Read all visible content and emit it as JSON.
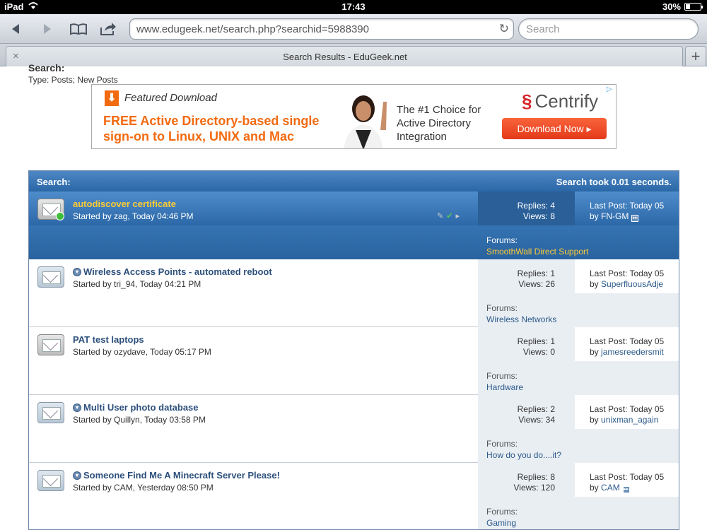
{
  "status": {
    "device": "iPad",
    "time": "17:43",
    "battery_text": "30%",
    "battery_level": 0.3
  },
  "browser": {
    "url": "www.edugeek.net/search.php?searchid=5988390",
    "search_placeholder": "Search",
    "tab_title": "Search Results - EduGeek.net"
  },
  "page": {
    "search_label": "Search:",
    "search_type": "Type: Posts; New Posts"
  },
  "ad": {
    "featured": "Featured Download",
    "headline": "FREE Active Directory-based single sign-on to Linux, UNIX and Mac",
    "tagline": "The #1 Choice for Active Directory Integration",
    "brand": "Centrify",
    "button": "Download Now ▸"
  },
  "results": {
    "header_left": "Search:",
    "header_right": "Search took 0.01 seconds.",
    "rows": [
      {
        "title": "autodiscover certificate",
        "started": "Started by zag, Today 04:46 PM",
        "replies": "Replies: 4",
        "views": "Views: 8",
        "last_post": "Last Post: Today 05",
        "last_by": "by",
        "last_user": "FN-GM",
        "forums_label": "Forums:",
        "forum": "SmoothWall Direct Support"
      },
      {
        "title": "Wireless Access Points - automated reboot",
        "started": "Started by tri_94, Today 04:21 PM",
        "replies": "Replies: 1",
        "views": "Views: 26",
        "last_post": "Last Post: Today 05",
        "last_by": "by",
        "last_user": "SuperfluousAdje",
        "forums_label": "Forums:",
        "forum": "Wireless Networks"
      },
      {
        "title": "PAT test laptops",
        "started": "Started by ozydave, Today 05:17 PM",
        "replies": "Replies: 1",
        "views": "Views: 0",
        "last_post": "Last Post: Today 05",
        "last_by": "by",
        "last_user": "jamesreedersmit",
        "forums_label": "Forums:",
        "forum": "Hardware"
      },
      {
        "title": "Multi User photo database",
        "started": "Started by Quillyn, Today 03:58 PM",
        "replies": "Replies: 2",
        "views": "Views: 34",
        "last_post": "Last Post: Today 05",
        "last_by": "by",
        "last_user": "unixman_again",
        "forums_label": "Forums:",
        "forum": "How do you do....it?"
      },
      {
        "title": "Someone Find Me A Minecraft Server Please!",
        "started": "Started by CAM, Yesterday 08:50 PM",
        "replies": "Replies: 8",
        "views": "Views: 120",
        "last_post": "Last Post: Today 05",
        "last_by": "by",
        "last_user": "CAM",
        "forums_label": "Forums:",
        "forum": "Gaming"
      }
    ]
  }
}
